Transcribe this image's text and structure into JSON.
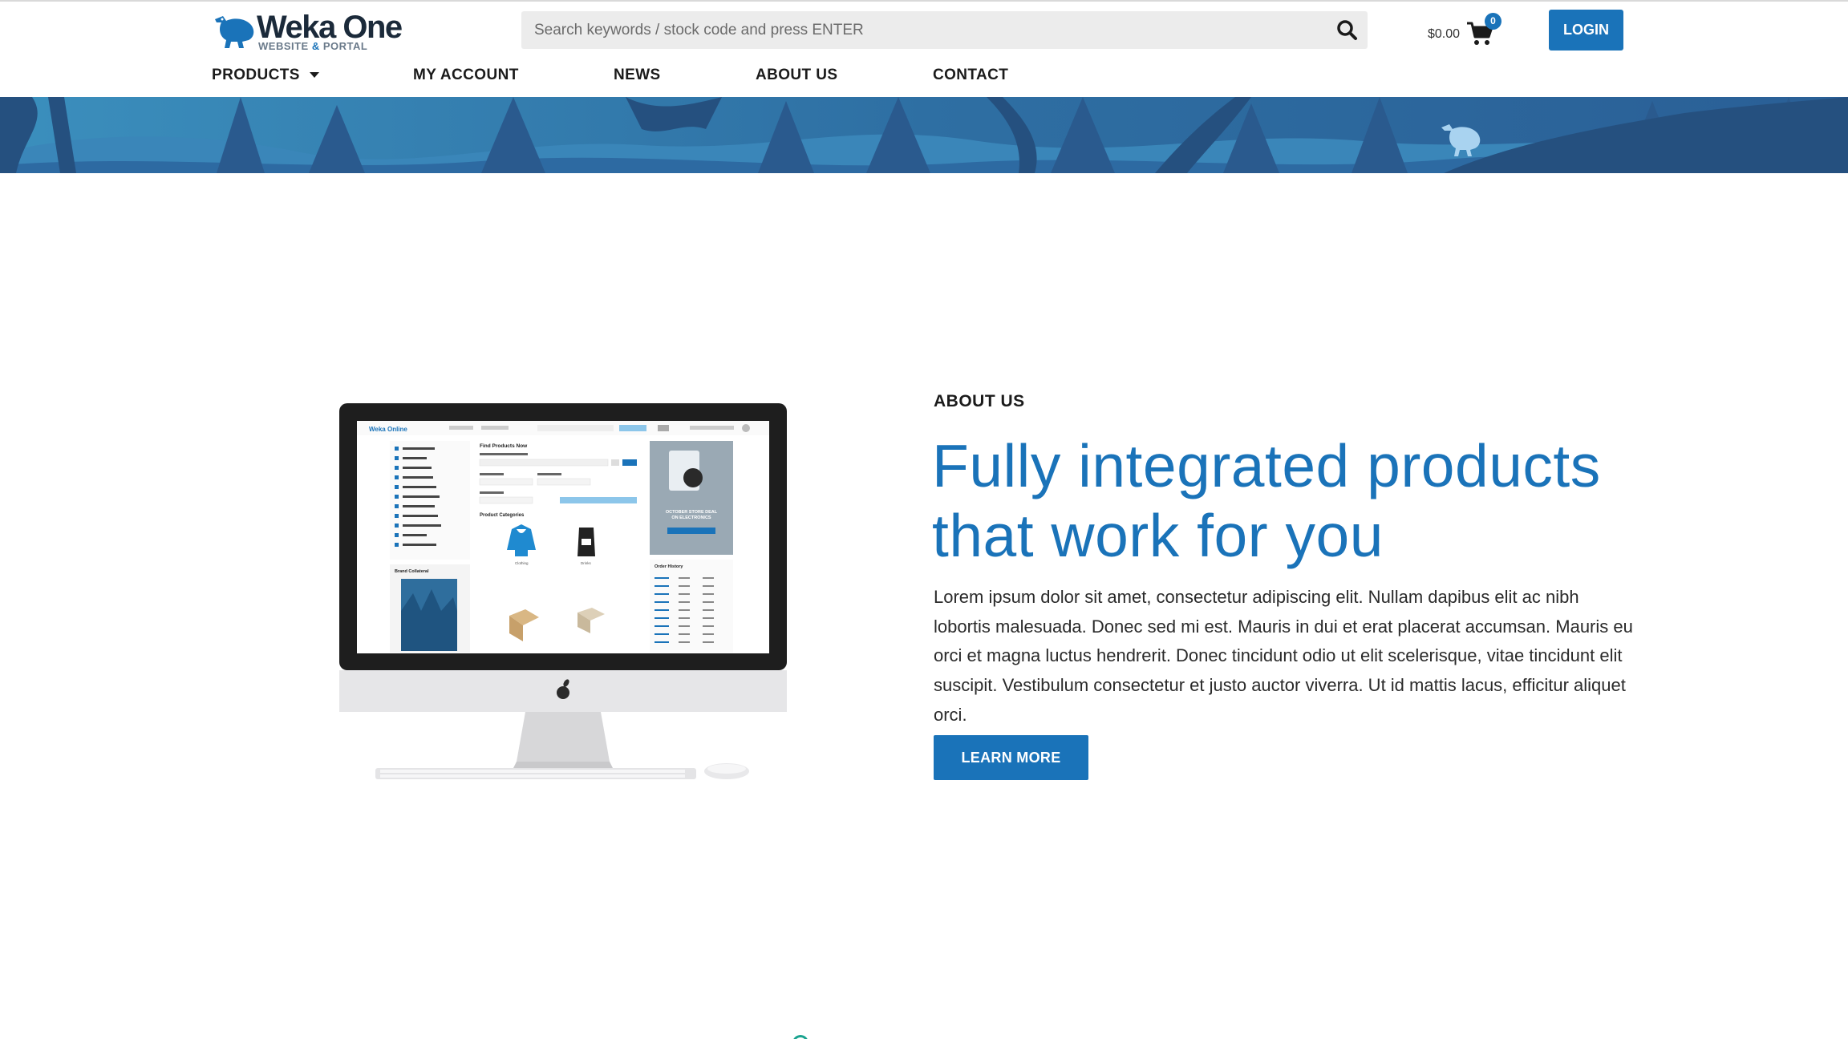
{
  "brand": {
    "name": "Weka One",
    "subtitle_a": "WEBSITE",
    "subtitle_amp": "&",
    "subtitle_b": "PORTAL"
  },
  "search": {
    "placeholder": "Search keywords / stock code and press ENTER"
  },
  "cart": {
    "total": "$0.00",
    "count": "0"
  },
  "header": {
    "login_label": "LOGIN"
  },
  "nav": {
    "products": "PRODUCTS",
    "my_account": "MY ACCOUNT",
    "news": "NEWS",
    "about_us": "ABOUT US",
    "contact": "CONTACT"
  },
  "about": {
    "eyebrow": "ABOUT US",
    "headline_line1": "Fully integrated products",
    "headline_line2": "that work for you",
    "body": "Lorem ipsum dolor sit amet, consectetur adipiscing elit. Nullam dapibus elit ac nibh lobortis malesuada. Donec sed mi est. Mauris in dui et erat placerat accumsan. Mauris eu orci et magna luctus hendrerit. Donec tincidunt odio ut elit scelerisque, vitae tincidunt elit suscipit. Vestibulum consectetur et justo auctor viverra. Ut id mattis lacus, efficitur aliquet orci.",
    "cta_label": "LEARN MORE"
  },
  "imac_screen": {
    "brand": "Weka Online",
    "panel_title": "Find Products Now",
    "categories_title": "Product Categories",
    "category_1": "Clothing",
    "category_2": "Drinks",
    "promo": "OCTOBER STORE DEAL ON ELECTRONICS",
    "order_history": "Order History",
    "brand_collateral": "Brand Collateral"
  },
  "colors": {
    "accent": "#1a73b9",
    "banner_dark": "#274d7d",
    "banner_light": "#3d8fbf",
    "text_dark": "#1b1b1b"
  },
  "icons": {
    "search": "search-icon",
    "cart": "cart-icon",
    "caret": "caret-down-icon",
    "logo": "weka-bird-icon"
  }
}
